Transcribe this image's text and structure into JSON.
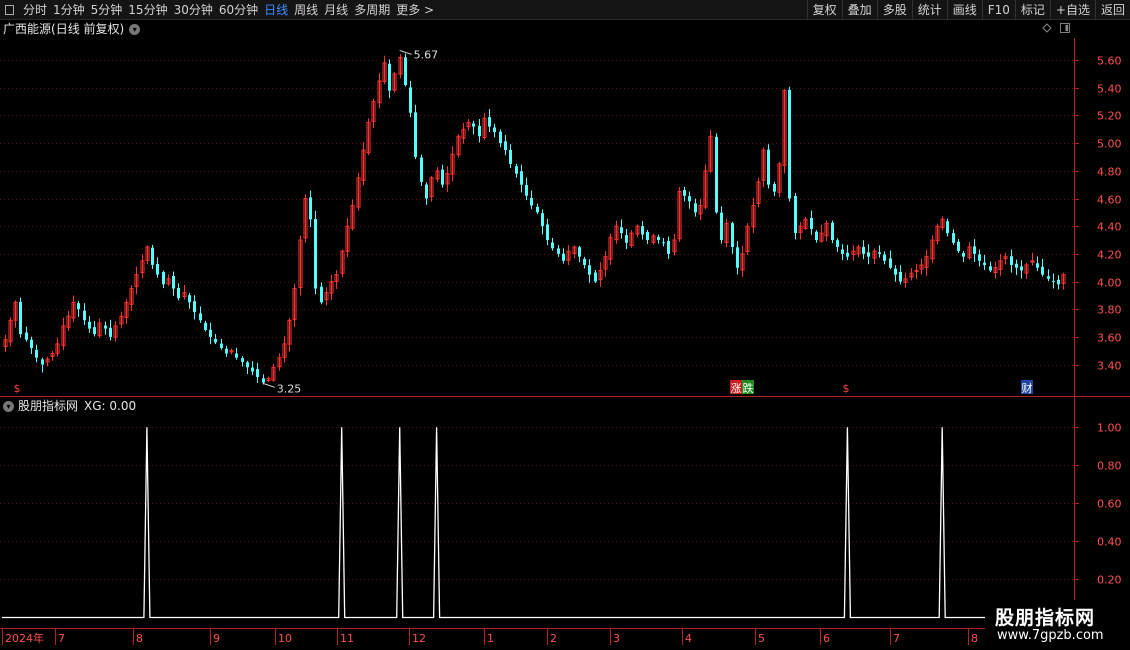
{
  "toolbar": {
    "periods": [
      "分时",
      "1分钟",
      "5分钟",
      "15分钟",
      "30分钟",
      "60分钟",
      "日线",
      "周线",
      "月线",
      "多周期",
      "更多 >"
    ],
    "active_period": "日线",
    "actions": [
      "复权",
      "叠加",
      "多股",
      "统计",
      "画线",
      "F10",
      "标记",
      "+自选",
      "返回"
    ]
  },
  "main_panel": {
    "stock_name": "广西能源",
    "mode": "(日线 前复权)",
    "high_label": "5.67",
    "low_label": "3.25",
    "markers": [
      "$",
      "涨",
      "跌",
      "$",
      "财"
    ]
  },
  "indicator_panel": {
    "name": "股朋指标网",
    "value_text": "XG: 0.00"
  },
  "watermark": {
    "title": "股朋指标网",
    "url": "www.7gpzb.com"
  },
  "colors": {
    "up": "#ff3232",
    "down": "#54ffff",
    "axis": "#b22222",
    "grid": "#5a1010",
    "signal": "#ffffff"
  },
  "chart_data": [
    {
      "type": "candlestick",
      "title": "广西能源 (日线 前复权)",
      "y_ticks": [
        3.4,
        3.6,
        3.8,
        4.0,
        4.2,
        4.4,
        4.6,
        4.8,
        5.0,
        5.2,
        5.4,
        5.6
      ],
      "ylim": [
        3.18,
        5.76
      ],
      "x_ticks": [
        "2024年",
        "7",
        "8",
        "9",
        "10",
        "11",
        "12",
        "1",
        "2",
        "3",
        "4",
        "5",
        "6",
        "7",
        "8"
      ],
      "annotations": {
        "high": 5.67,
        "low": 3.25
      },
      "series": [
        {
          "name": "close",
          "values": [
            3.58,
            3.72,
            3.85,
            3.62,
            3.58,
            3.52,
            3.45,
            3.4,
            3.44,
            3.48,
            3.55,
            3.68,
            3.75,
            3.85,
            3.8,
            3.72,
            3.66,
            3.62,
            3.7,
            3.66,
            3.6,
            3.68,
            3.75,
            3.85,
            3.95,
            4.05,
            4.15,
            4.25,
            4.12,
            4.05,
            3.98,
            4.02,
            3.95,
            3.88,
            3.92,
            3.85,
            3.78,
            3.72,
            3.65,
            3.6,
            3.56,
            3.52,
            3.48,
            3.5,
            3.45,
            3.42,
            3.38,
            3.35,
            3.31,
            3.27,
            3.3,
            3.38,
            3.45,
            3.55,
            3.72,
            3.95,
            4.3,
            4.6,
            4.45,
            3.95,
            3.85,
            3.92,
            4.0,
            4.05,
            4.22,
            4.4,
            4.55,
            4.75,
            4.95,
            5.15,
            5.3,
            5.45,
            5.58,
            5.38,
            5.5,
            5.62,
            5.42,
            5.22,
            4.9,
            4.72,
            4.6,
            4.75,
            4.8,
            4.7,
            4.78,
            4.92,
            5.05,
            5.1,
            5.15,
            5.12,
            5.05,
            5.18,
            5.12,
            5.08,
            5.0,
            4.95,
            4.85,
            4.78,
            4.7,
            4.62,
            4.55,
            4.5,
            4.4,
            4.3,
            4.24,
            4.2,
            4.15,
            4.22,
            4.25,
            4.18,
            4.12,
            4.05,
            4.0,
            4.08,
            4.18,
            4.32,
            4.4,
            4.35,
            4.28,
            4.35,
            4.4,
            4.34,
            4.3,
            4.33,
            4.3,
            4.28,
            4.2,
            4.3,
            4.65,
            4.62,
            4.58,
            4.5,
            4.55,
            4.8,
            5.05,
            4.5,
            4.3,
            4.42,
            4.25,
            4.1,
            4.2,
            4.4,
            4.55,
            4.72,
            4.95,
            4.7,
            4.65,
            4.85,
            5.38,
            4.6,
            4.35,
            4.4,
            4.45,
            4.38,
            4.3,
            4.35,
            4.42,
            4.3,
            4.25,
            4.2,
            4.18,
            4.22,
            4.25,
            4.2,
            4.18,
            4.22,
            4.2,
            4.15,
            4.1,
            4.05,
            4.0,
            4.02,
            4.06,
            4.08,
            4.12,
            4.18,
            4.3,
            4.4,
            4.45,
            4.35,
            4.28,
            4.22,
            4.18,
            4.25,
            4.2,
            4.15,
            4.12,
            4.08,
            4.1,
            4.15,
            4.18,
            4.12,
            4.1,
            4.08,
            4.12,
            4.15,
            4.1,
            4.05,
            4.02,
            4.0,
            3.98,
            4.05
          ]
        }
      ]
    },
    {
      "type": "line",
      "title": "股朋指标网 XG",
      "y_ticks": [
        0.2,
        0.4,
        0.6,
        0.8,
        1.0
      ],
      "ylim": [
        -0.05,
        1.07
      ],
      "x_ticks": [
        "2024年",
        "7",
        "8",
        "9",
        "10",
        "11",
        "12",
        "1",
        "2",
        "3",
        "4",
        "5",
        "6",
        "7",
        "8"
      ],
      "series": [
        {
          "name": "XG",
          "signal_bar_indices": [
            27,
            64,
            75,
            82,
            160,
            178
          ],
          "values_at_signals": 1,
          "baseline": 0
        }
      ]
    }
  ]
}
